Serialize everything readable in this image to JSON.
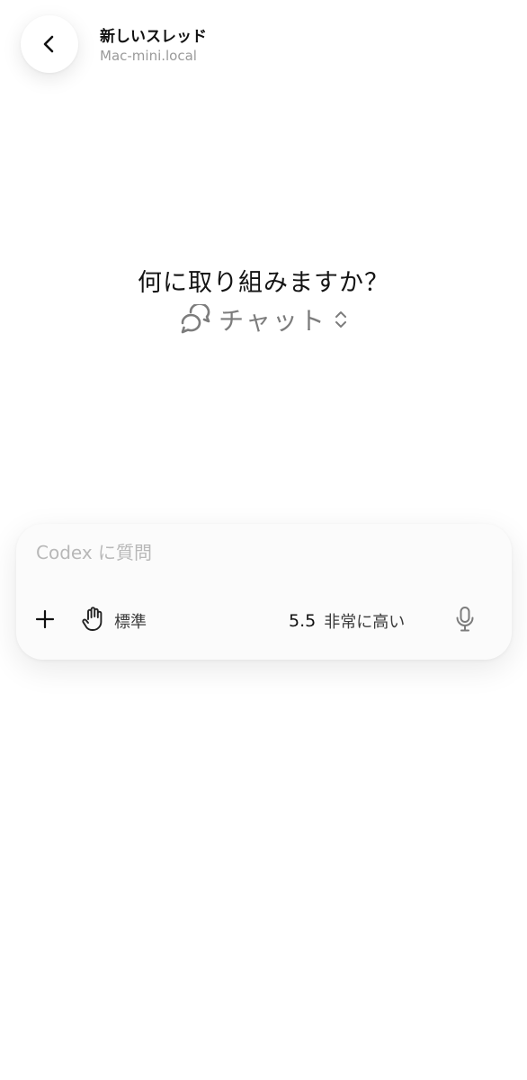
{
  "header": {
    "back_icon": "chevron-left-icon",
    "title": "新しいスレッド",
    "subtitle": "Mac-mini.local"
  },
  "prompt": {
    "heading": "何に取り組みますか？",
    "mode": {
      "icon": "chat-bubbles-icon",
      "label": "チャット",
      "toggle_icon": "chevron-up-down-icon"
    }
  },
  "composer": {
    "placeholder": "Codex に質問",
    "value": "",
    "add_icon": "plus-icon",
    "permission": {
      "icon": "hand-icon",
      "label": "標準"
    },
    "model": {
      "version": "5.5",
      "effort": "非常に高い"
    },
    "mic_icon": "microphone-icon"
  },
  "colors": {
    "background": "#ffffff",
    "text_primary": "#111111",
    "text_secondary": "#9a9a9a",
    "mode_gray": "#7c7c7c",
    "placeholder": "#b8b8b8",
    "composer_bg": "#fbfbfb"
  }
}
